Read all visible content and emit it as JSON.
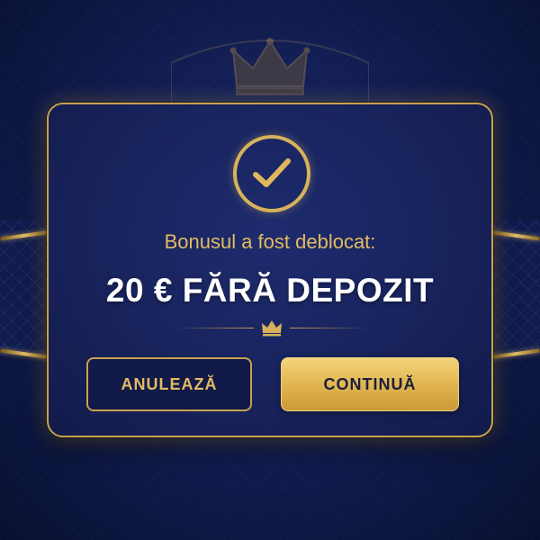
{
  "dialog": {
    "subtitle": "Bonusul a fost deblocat:",
    "headline": "20 € FĂRĂ DEPOZIT",
    "cancel_label": "ANULEAZĂ",
    "continue_label": "CONTINUĂ"
  },
  "icons": {
    "status": "checkmark-icon",
    "divider": "crown-icon",
    "background": "crown-icon"
  },
  "colors": {
    "accent_gold": "#d8b25a",
    "background_navy": "#142058",
    "headline_text": "#ffffff",
    "continue_button": "#e2b650"
  }
}
